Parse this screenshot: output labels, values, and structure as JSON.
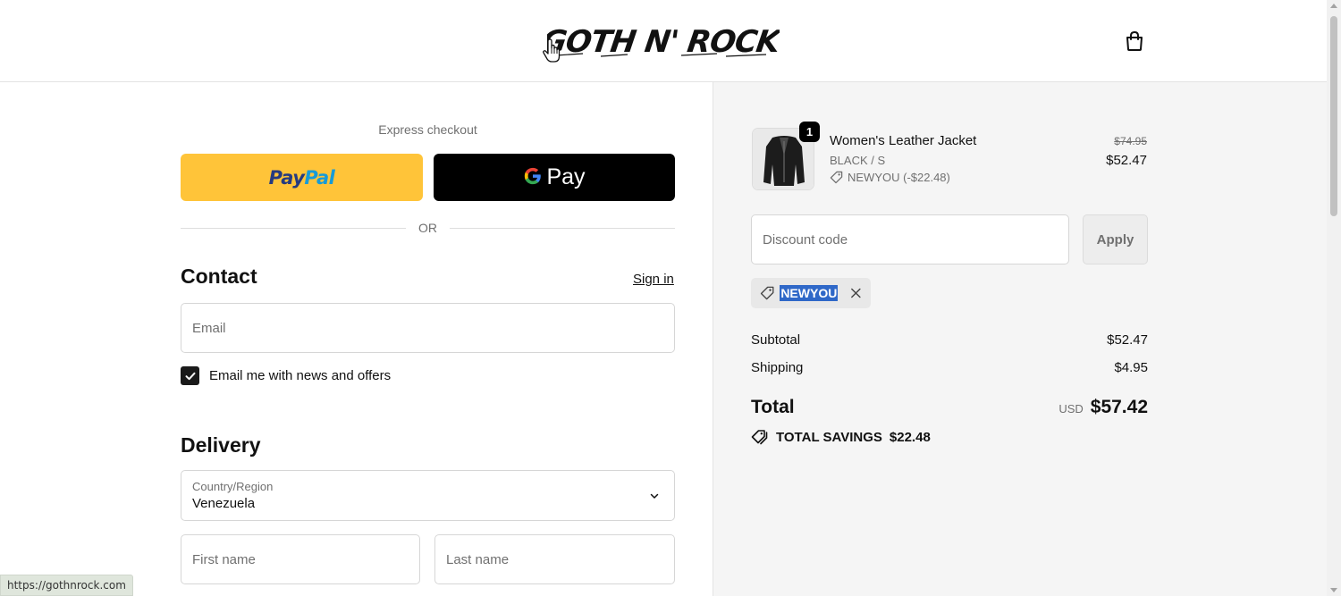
{
  "header": {
    "logo_text": "GOTH N' ROCK",
    "cart_icon": "shopping-bag-icon"
  },
  "express": {
    "label": "Express checkout",
    "paypal_part1": "Pay",
    "paypal_part2": "Pal",
    "gpay_label": "Pay",
    "or_label": "OR"
  },
  "contact": {
    "heading": "Contact",
    "signin_label": "Sign in",
    "email_placeholder": "Email",
    "newsletter_label": "Email me with news and offers",
    "newsletter_checked": true
  },
  "delivery": {
    "heading": "Delivery",
    "country_label": "Country/Region",
    "country_value": "Venezuela",
    "first_name_placeholder": "First name",
    "last_name_placeholder": "Last name"
  },
  "order": {
    "item": {
      "name": "Women's Leather Jacket",
      "variant": "BLACK / S",
      "discount": "NEWYOU (-$22.48)",
      "quantity": "1",
      "original_price": "$74.95",
      "price": "$52.47"
    },
    "discount_placeholder": "Discount code",
    "apply_label": "Apply",
    "applied_code": "NEWYOU",
    "subtotal_label": "Subtotal",
    "subtotal_value": "$52.47",
    "shipping_label": "Shipping",
    "shipping_value": "$4.95",
    "total_label": "Total",
    "currency": "USD",
    "total_value": "$57.42",
    "savings_label": "TOTAL SAVINGS",
    "savings_value": "$22.48"
  },
  "status_bar": {
    "url": "https://gothnrock.com"
  },
  "colors": {
    "paypal_yellow": "#ffc439",
    "paypal_dark_blue": "#253b80",
    "paypal_light_blue": "#179bd7",
    "gpay_black": "#000000",
    "selection_blue": "#2f68c8",
    "summary_bg": "#f5f5f5"
  }
}
